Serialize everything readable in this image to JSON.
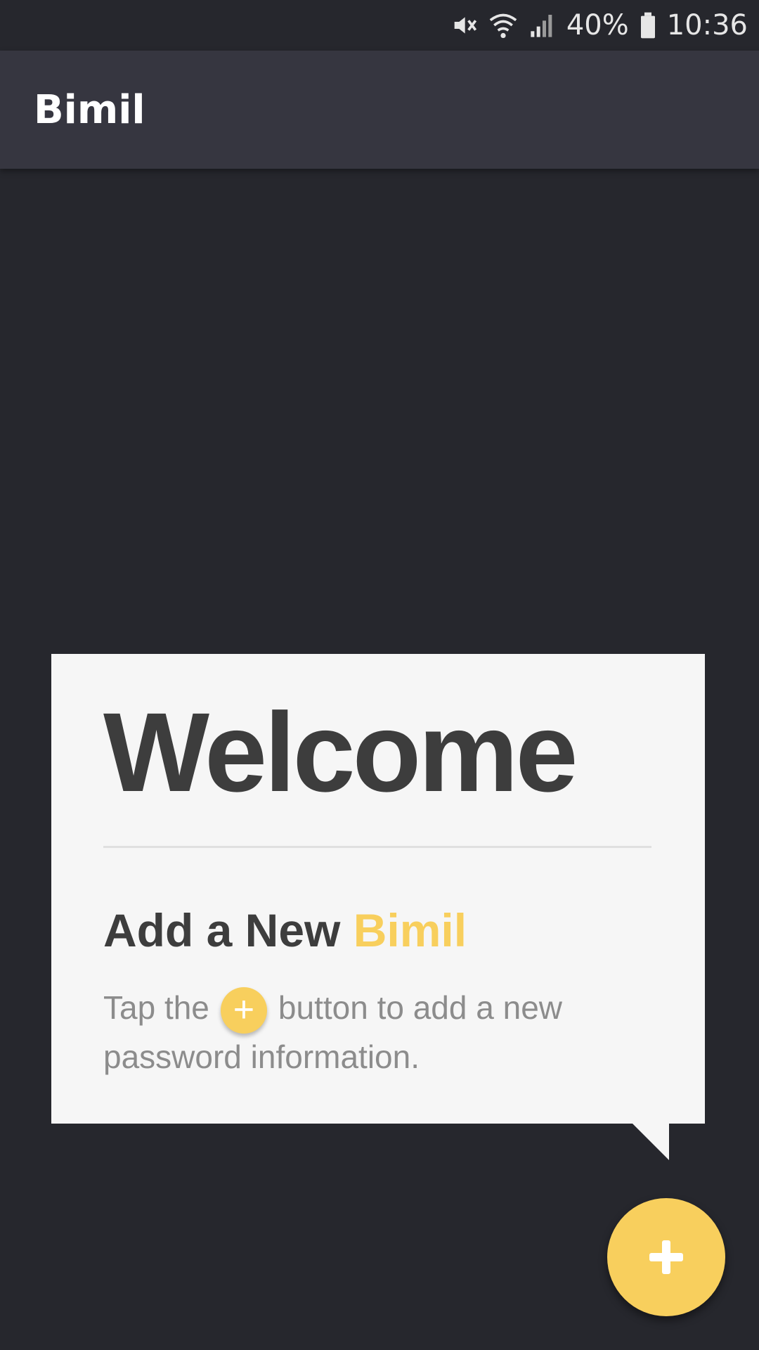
{
  "status_bar": {
    "battery": "40%",
    "time": "10:36",
    "icons": [
      "mute-icon",
      "wifi-icon",
      "signal-icon",
      "battery-icon"
    ]
  },
  "app_bar": {
    "title": "Bimil"
  },
  "welcome_card": {
    "heading": "Welcome",
    "subheading_prefix": "Add a New ",
    "subheading_accent": "Bimil",
    "instruction_before": "Tap the",
    "instruction_icon": "plus-icon",
    "instruction_after": "button to add a new password information."
  },
  "fab": {
    "icon": "plus-icon"
  },
  "colors": {
    "background": "#26272d",
    "app_bar": "#363640",
    "accent": "#f8cf5d",
    "card": "#f6f6f6",
    "heading_text": "#3d3d3d",
    "body_text": "#8c8c8c"
  }
}
